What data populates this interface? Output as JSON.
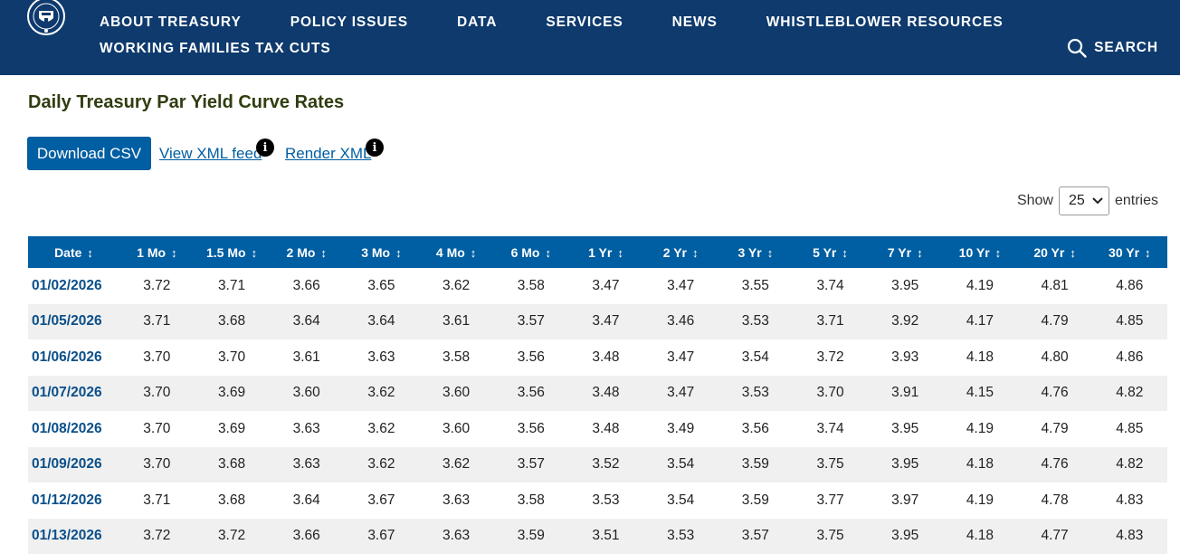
{
  "header": {
    "nav_row1": [
      "ABOUT TREASURY",
      "POLICY ISSUES",
      "DATA",
      "SERVICES",
      "NEWS",
      "WHISTLEBLOWER RESOURCES"
    ],
    "nav_row2": [
      "WORKING FAMILIES TAX CUTS"
    ],
    "search_label": "SEARCH",
    "colors": {
      "background": "#0e3a6d",
      "text": "#ffffff"
    }
  },
  "page": {
    "title": "Daily Treasury Par Yield Curve Rates",
    "download_label": "Download CSV",
    "xml_feed_label": "View XML feed",
    "render_xml_label": "Render XML",
    "info_glyph": "i"
  },
  "entries_control": {
    "show_label": "Show",
    "selected_value": "25",
    "entries_label": "entries"
  },
  "table": {
    "columns": [
      "Date",
      "1 Mo",
      "1.5 Mo",
      "2 Mo",
      "3 Mo",
      "4 Mo",
      "6 Mo",
      "1 Yr",
      "2 Yr",
      "3 Yr",
      "5 Yr",
      "7 Yr",
      "10 Yr",
      "20 Yr",
      "30 Yr"
    ],
    "rows": [
      [
        "01/02/2026",
        "3.72",
        "3.71",
        "3.66",
        "3.65",
        "3.62",
        "3.58",
        "3.47",
        "3.47",
        "3.55",
        "3.74",
        "3.95",
        "4.19",
        "4.81",
        "4.86"
      ],
      [
        "01/05/2026",
        "3.71",
        "3.68",
        "3.64",
        "3.64",
        "3.61",
        "3.57",
        "3.47",
        "3.46",
        "3.53",
        "3.71",
        "3.92",
        "4.17",
        "4.79",
        "4.85"
      ],
      [
        "01/06/2026",
        "3.70",
        "3.70",
        "3.61",
        "3.63",
        "3.58",
        "3.56",
        "3.48",
        "3.47",
        "3.54",
        "3.72",
        "3.93",
        "4.18",
        "4.80",
        "4.86"
      ],
      [
        "01/07/2026",
        "3.70",
        "3.69",
        "3.60",
        "3.62",
        "3.60",
        "3.56",
        "3.48",
        "3.47",
        "3.53",
        "3.70",
        "3.91",
        "4.15",
        "4.76",
        "4.82"
      ],
      [
        "01/08/2026",
        "3.70",
        "3.69",
        "3.63",
        "3.62",
        "3.60",
        "3.56",
        "3.48",
        "3.49",
        "3.56",
        "3.74",
        "3.95",
        "4.19",
        "4.79",
        "4.85"
      ],
      [
        "01/09/2026",
        "3.70",
        "3.68",
        "3.63",
        "3.62",
        "3.62",
        "3.57",
        "3.52",
        "3.54",
        "3.59",
        "3.75",
        "3.95",
        "4.18",
        "4.76",
        "4.82"
      ],
      [
        "01/12/2026",
        "3.71",
        "3.68",
        "3.64",
        "3.67",
        "3.63",
        "3.58",
        "3.53",
        "3.54",
        "3.59",
        "3.77",
        "3.97",
        "4.19",
        "4.78",
        "4.83"
      ],
      [
        "01/13/2026",
        "3.72",
        "3.72",
        "3.66",
        "3.67",
        "3.63",
        "3.59",
        "3.51",
        "3.53",
        "3.57",
        "3.75",
        "3.95",
        "4.18",
        "4.77",
        "4.83"
      ]
    ]
  }
}
